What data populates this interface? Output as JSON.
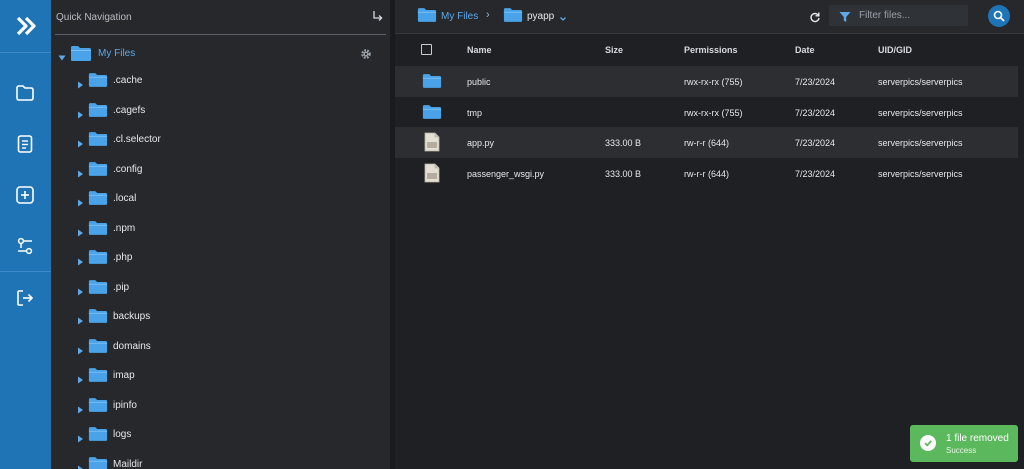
{
  "rail": {
    "items": [
      {
        "icon": "logo-arrow-icon"
      },
      {
        "icon": "folder-icon"
      },
      {
        "icon": "document-icon"
      },
      {
        "icon": "add-square-icon"
      },
      {
        "icon": "settings-sliders-icon"
      },
      {
        "icon": "logout-icon"
      }
    ]
  },
  "tree": {
    "title": "Quick Navigation",
    "root_label": "My Files",
    "items": [
      {
        "label": ".cache"
      },
      {
        "label": ".cagefs"
      },
      {
        "label": ".cl.selector"
      },
      {
        "label": ".config"
      },
      {
        "label": ".local"
      },
      {
        "label": ".npm"
      },
      {
        "label": ".php"
      },
      {
        "label": ".pip"
      },
      {
        "label": "backups"
      },
      {
        "label": "domains"
      },
      {
        "label": "imap"
      },
      {
        "label": "ipinfo"
      },
      {
        "label": "logs"
      },
      {
        "label": "Maildir"
      }
    ]
  },
  "breadcrumb": {
    "root": "My Files",
    "separator": "›",
    "current": "pyapp"
  },
  "filter": {
    "placeholder": "Filter files..."
  },
  "table": {
    "columns": [
      "Name",
      "Size",
      "Permissions",
      "Date",
      "UID/GID"
    ],
    "rows": [
      {
        "type": "folder",
        "name": "public",
        "size": "",
        "permissions": "rwx-rx-rx (755)",
        "date": "7/23/2024",
        "uidgid": "serverpics/serverpics"
      },
      {
        "type": "folder",
        "name": "tmp",
        "size": "",
        "permissions": "rwx-rx-rx (755)",
        "date": "7/23/2024",
        "uidgid": "serverpics/serverpics"
      },
      {
        "type": "file",
        "name": "app.py",
        "size": "333.00 B",
        "permissions": "rw-r-r (644)",
        "date": "7/23/2024",
        "uidgid": "serverpics/serverpics"
      },
      {
        "type": "file",
        "name": "passenger_wsgi.py",
        "size": "333.00 B",
        "permissions": "rw-r-r (644)",
        "date": "7/23/2024",
        "uidgid": "serverpics/serverpics"
      }
    ]
  },
  "toast": {
    "message": "1 file removed",
    "status": "Success"
  },
  "colors": {
    "rail": "#1f74b5",
    "accent": "#5fa8e8",
    "folder": "#4aa3e8",
    "success": "#5cb85c"
  }
}
